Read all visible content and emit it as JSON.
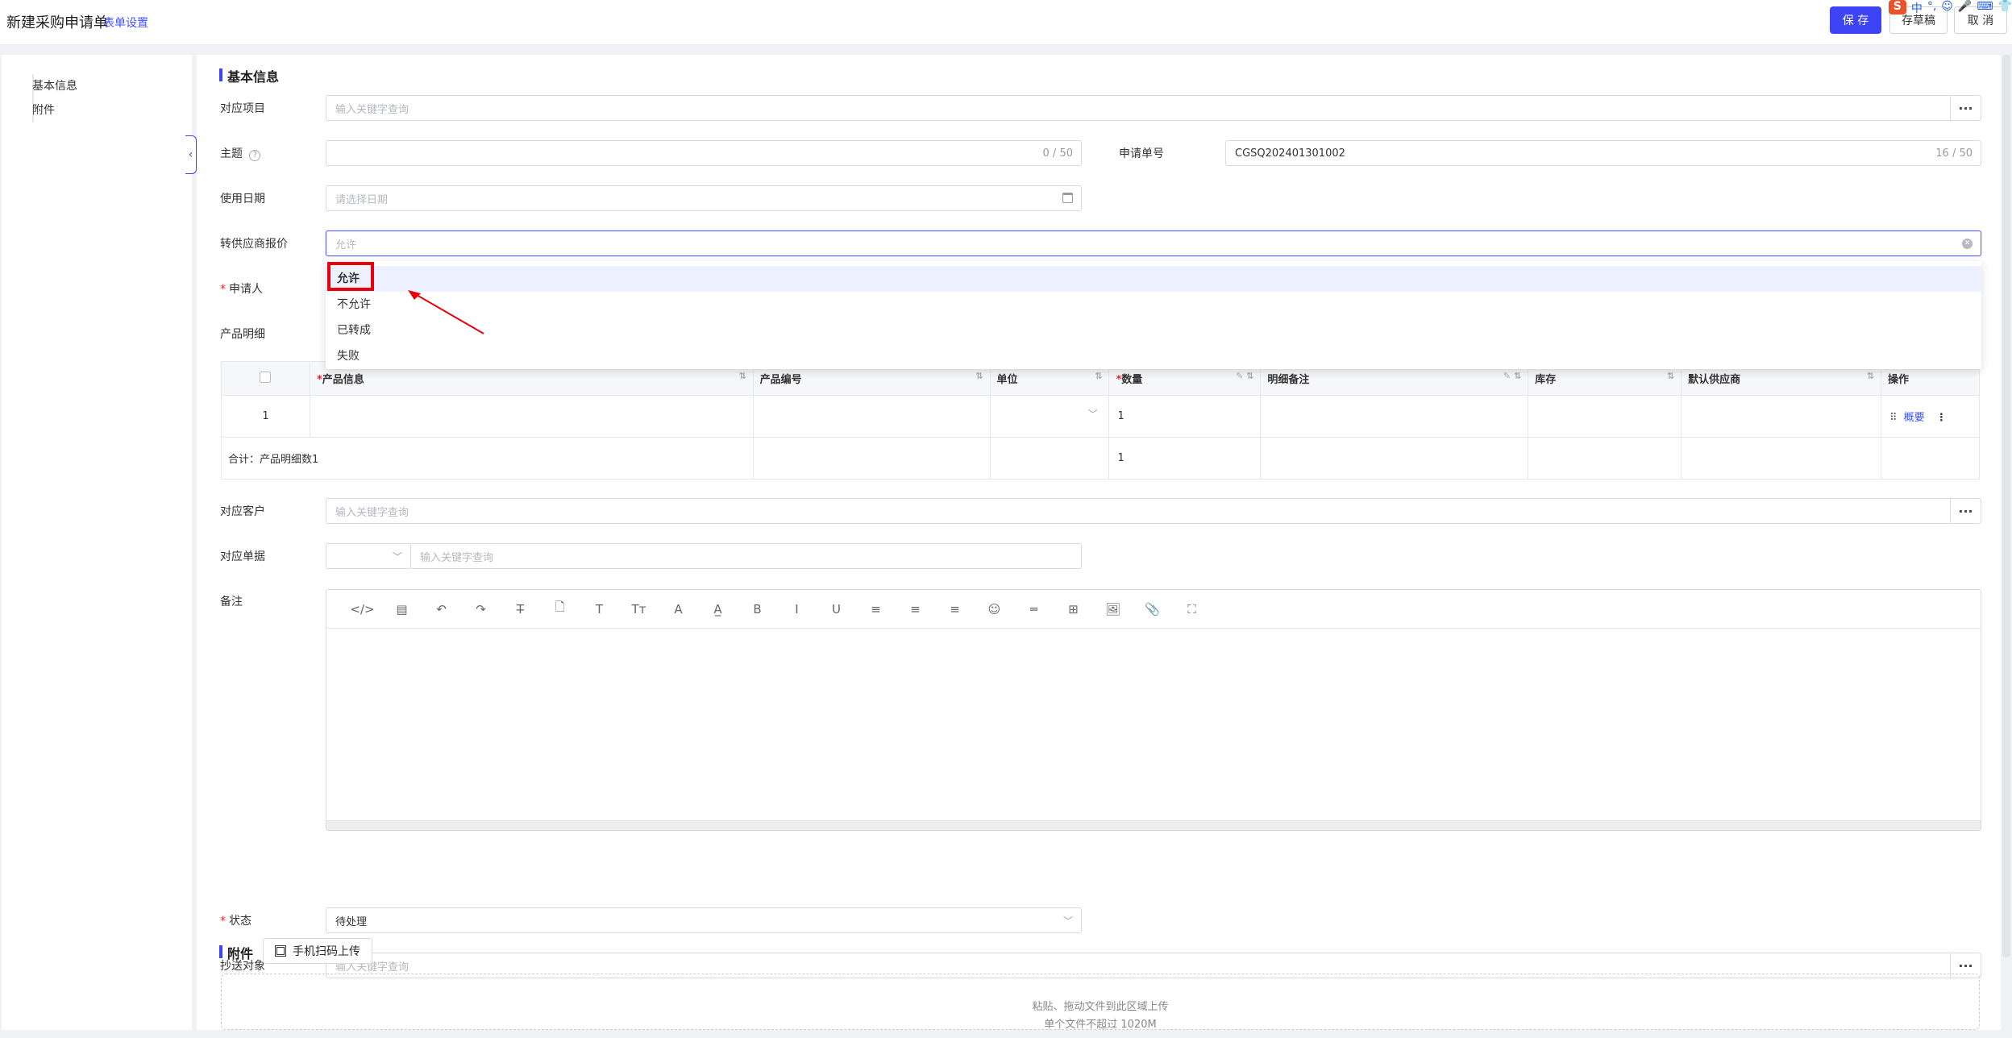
{
  "header": {
    "title": "新建采购申请单",
    "form_settings": "表单设置",
    "save": "保 存",
    "draft": "存草稿",
    "cancel": "取 消",
    "ime": [
      "S",
      "中",
      "°,",
      "☺",
      "🎤",
      "⌨",
      "👕"
    ]
  },
  "sidebar": {
    "items": [
      "基本信息",
      "附件"
    ],
    "collapse_icon": "‹"
  },
  "form": {
    "section_basic": "基本信息",
    "project_label": "对应项目",
    "project_placeholder": "输入关键字查询",
    "subject_label": "主题",
    "subject_help_icon": "?",
    "subject_count": "0 / 50",
    "apply_no_label": "申请单号",
    "apply_no_value": "CGSQ202401301002",
    "apply_no_count": "16 / 50",
    "date_label": "使用日期",
    "date_placeholder": "请选择日期",
    "supplier_quote_label": "转供应商报价",
    "supplier_quote_placeholder": "允许",
    "applicant_label": "申请人",
    "products_label": "产品明细",
    "customer_label": "对应客户",
    "customer_placeholder": "输入关键字查询",
    "document_label": "对应单据",
    "document_placeholder": "输入关键字查询",
    "remark_label": "备注",
    "status_label": "状态",
    "status_value": "待处理",
    "cc_label": "抄送对象",
    "cc_placeholder": "输入关键字查询",
    "more": "···"
  },
  "dropdown": {
    "options": [
      "允许",
      "不允许",
      "已转成",
      "失败"
    ],
    "selected": "允许"
  },
  "table": {
    "headers": [
      "产品信息",
      "产品编号",
      "单位",
      "数量",
      "明细备注",
      "库存",
      "默认供应商",
      "操作"
    ],
    "row": {
      "index": "1",
      "quantity": "1",
      "overview": "概要"
    },
    "footer": {
      "summary": "合计：产品明细数1",
      "quantity": "1"
    }
  },
  "editor_tools": [
    "</>",
    "▤",
    "↶",
    "↷",
    "T̶",
    "🗋",
    "T",
    "Tт",
    "A",
    "A̲",
    "B",
    "I",
    "U",
    "≡",
    "≡",
    "≡",
    "☺",
    "═",
    "⊞",
    "🖼",
    "📎",
    "⛶"
  ],
  "attachment": {
    "section": "附件",
    "scan_button": "手机扫码上传",
    "drop_line1": "粘贴、拖动文件到此区域上传",
    "drop_line2": "单个文件不超过 1020M"
  }
}
